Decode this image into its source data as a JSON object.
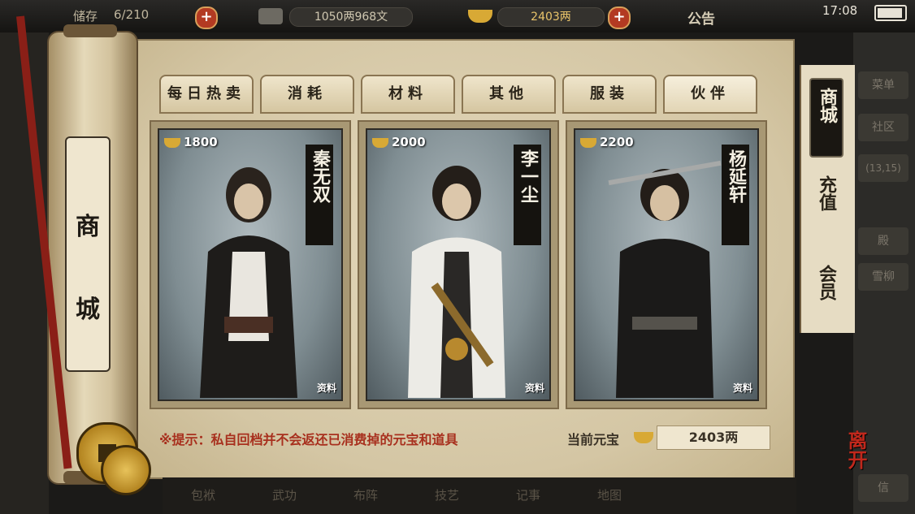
{
  "topbar": {
    "stock_label": "储存",
    "stock_value": "6/210",
    "money": "1050两968文",
    "gold": "2403两",
    "announce": "公告",
    "clock": "17:08"
  },
  "shop_title": [
    "商",
    "城"
  ],
  "tabs": [
    "每日热卖",
    "消耗",
    "材料",
    "其他",
    "服装",
    "伙伴"
  ],
  "active_tab": "伙伴",
  "partners": [
    {
      "name": "秦无双",
      "price": "1800",
      "detail": "资料"
    },
    {
      "name": "李一尘",
      "price": "2000",
      "detail": "资料"
    },
    {
      "name": "杨延轩",
      "price": "2200",
      "detail": "资料"
    }
  ],
  "side_tabs": {
    "active": "商城",
    "recharge": "充值",
    "member": "会员"
  },
  "hint": "※提示：私自回档并不会返还已消费掉的元宝和道具",
  "yuanbao": {
    "label": "当前元宝",
    "value": "2403两"
  },
  "leave": "离开",
  "dock": [
    "包袱",
    "武功",
    "布阵",
    "技艺",
    "记事",
    "地图"
  ],
  "right_menu": [
    "菜单",
    "社区",
    "(13,15)",
    "殿",
    "雪柳",
    "信"
  ],
  "colors": {
    "hint": "#a8301e",
    "parchment": "#d8ccae",
    "leave": "#c0281c"
  }
}
